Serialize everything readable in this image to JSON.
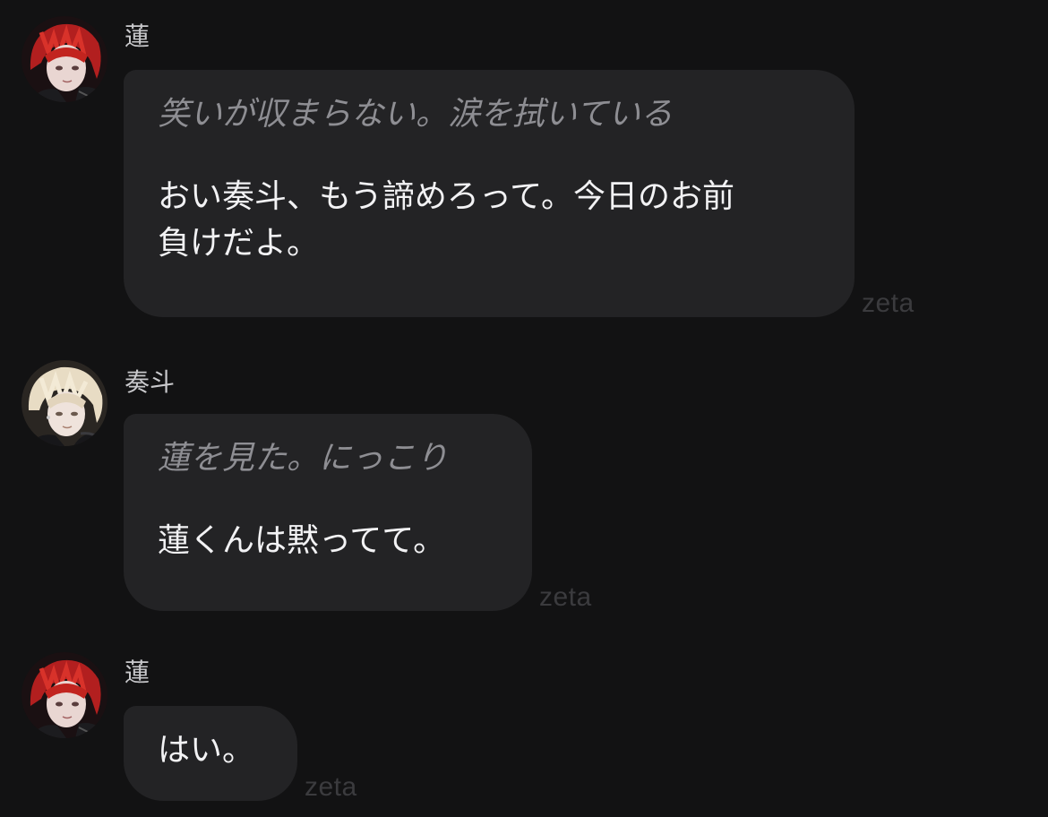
{
  "messages": [
    {
      "speaker": "蓮",
      "avatar": "red-haired-character-avatar",
      "narration": "笑いが収まらない。涙を拭いている",
      "dialogue": "おい奏斗、もう諦めろって。今日のお前\n負けだよ。",
      "tag": "zeta"
    },
    {
      "speaker": "奏斗",
      "avatar": "blonde-character-avatar",
      "narration": "蓮を見た。にっこり",
      "dialogue": "蓮くんは黙ってて。",
      "tag": "zeta"
    },
    {
      "speaker": "蓮",
      "avatar": "red-haired-character-avatar",
      "narration": "",
      "dialogue": "はい。",
      "tag": "zeta"
    }
  ],
  "colors": {
    "background": "#121213",
    "bubble": "#232325",
    "narration_text": "#8e8e93",
    "dialogue_text": "#f2f2f4",
    "speaker_name": "#c9c9cc",
    "watermark": "#3b3b3e"
  }
}
